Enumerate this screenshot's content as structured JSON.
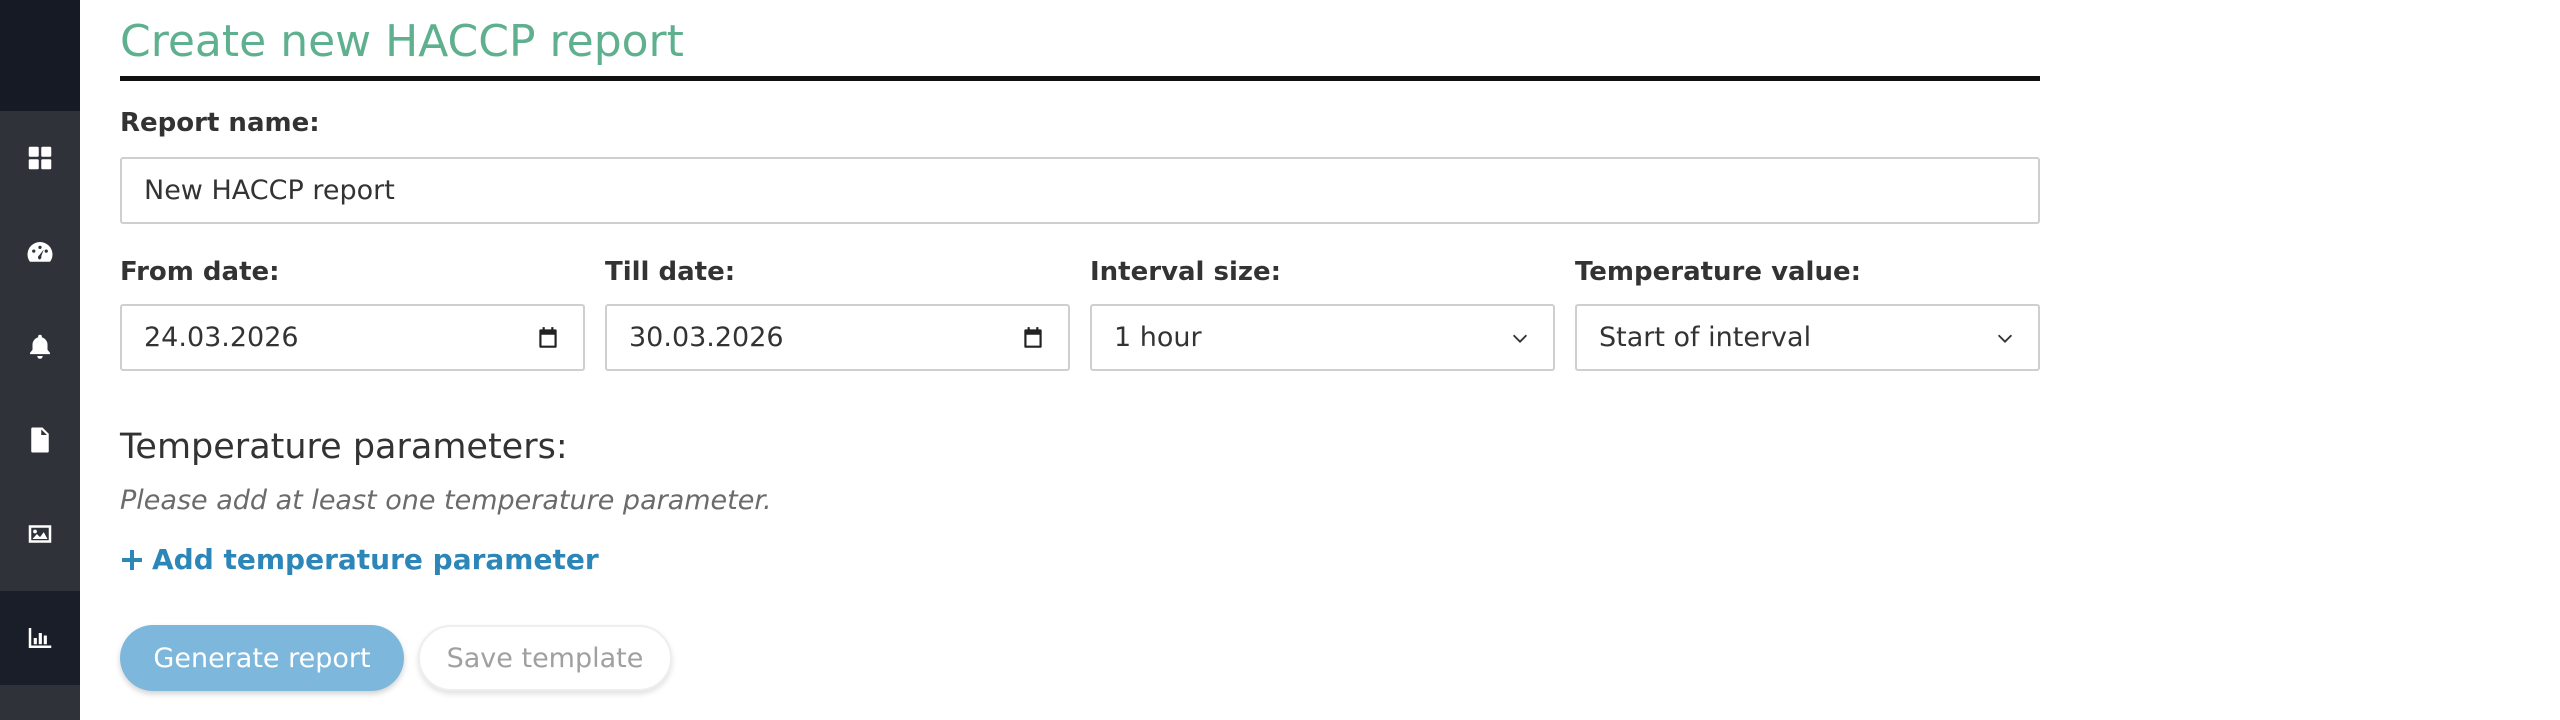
{
  "sidebar": {
    "items": [
      {
        "icon": "dashboard-icon"
      },
      {
        "icon": "gauge-icon"
      },
      {
        "icon": "bell-icon"
      },
      {
        "icon": "document-icon"
      },
      {
        "icon": "image-icon"
      },
      {
        "icon": "chart-icon",
        "active": true
      }
    ]
  },
  "page": {
    "title": "Create new HACCP report"
  },
  "form": {
    "report_name_label": "Report name:",
    "report_name_value": "New HACCP report",
    "from_date_label": "From date:",
    "from_date_value": "24.03.2026",
    "till_date_label": "Till date:",
    "till_date_value": "30.03.2026",
    "interval_label": "Interval size:",
    "interval_value": "1 hour",
    "temp_value_label": "Temperature value:",
    "temp_value_value": "Start of interval"
  },
  "parameters": {
    "heading": "Temperature parameters:",
    "hint": "Please add at least one temperature parameter.",
    "add_label": "Add temperature parameter"
  },
  "actions": {
    "generate_label": "Generate report",
    "save_label": "Save template"
  },
  "colors": {
    "accent_title": "#5fb08f",
    "link": "#2c86b8",
    "primary_button": "#7db8dc",
    "sidebar": "#2f3238"
  }
}
